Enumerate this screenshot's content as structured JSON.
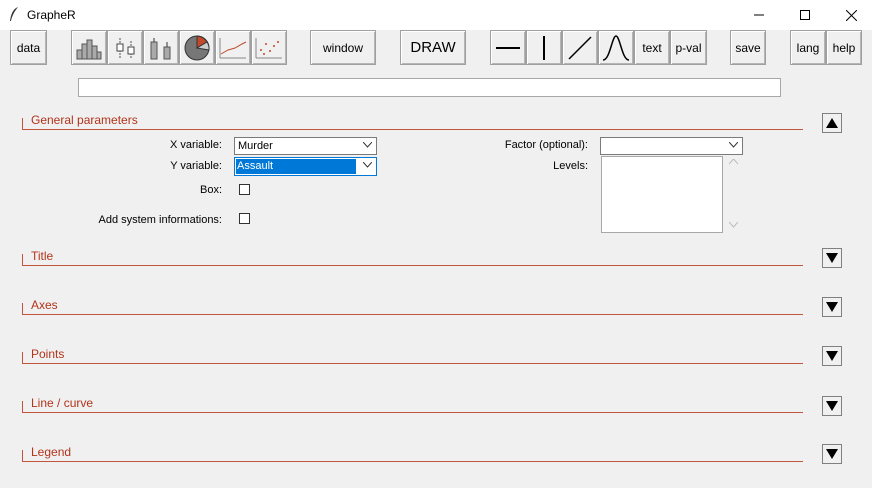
{
  "window": {
    "title": "GrapheR"
  },
  "toolbar": {
    "data": "data",
    "window": "window",
    "draw": "DRAW",
    "text": "text",
    "pval": "p-val",
    "save": "save",
    "lang": "lang",
    "help": "help"
  },
  "command_line": {
    "value": ""
  },
  "sections": {
    "general": "General parameters",
    "title": "Title",
    "axes": "Axes",
    "points": "Points",
    "line": "Line / curve",
    "legend": "Legend"
  },
  "general": {
    "x_label": "X variable:",
    "x_value": "Murder",
    "y_label": "Y variable:",
    "y_value": "Assault",
    "box_label": "Box:",
    "sysinfo_label": "Add system informations:",
    "factor_label": "Factor (optional):",
    "factor_value": "",
    "levels_label": "Levels:"
  },
  "colors": {
    "section": "#b1341b",
    "selection": "#0078d7"
  }
}
